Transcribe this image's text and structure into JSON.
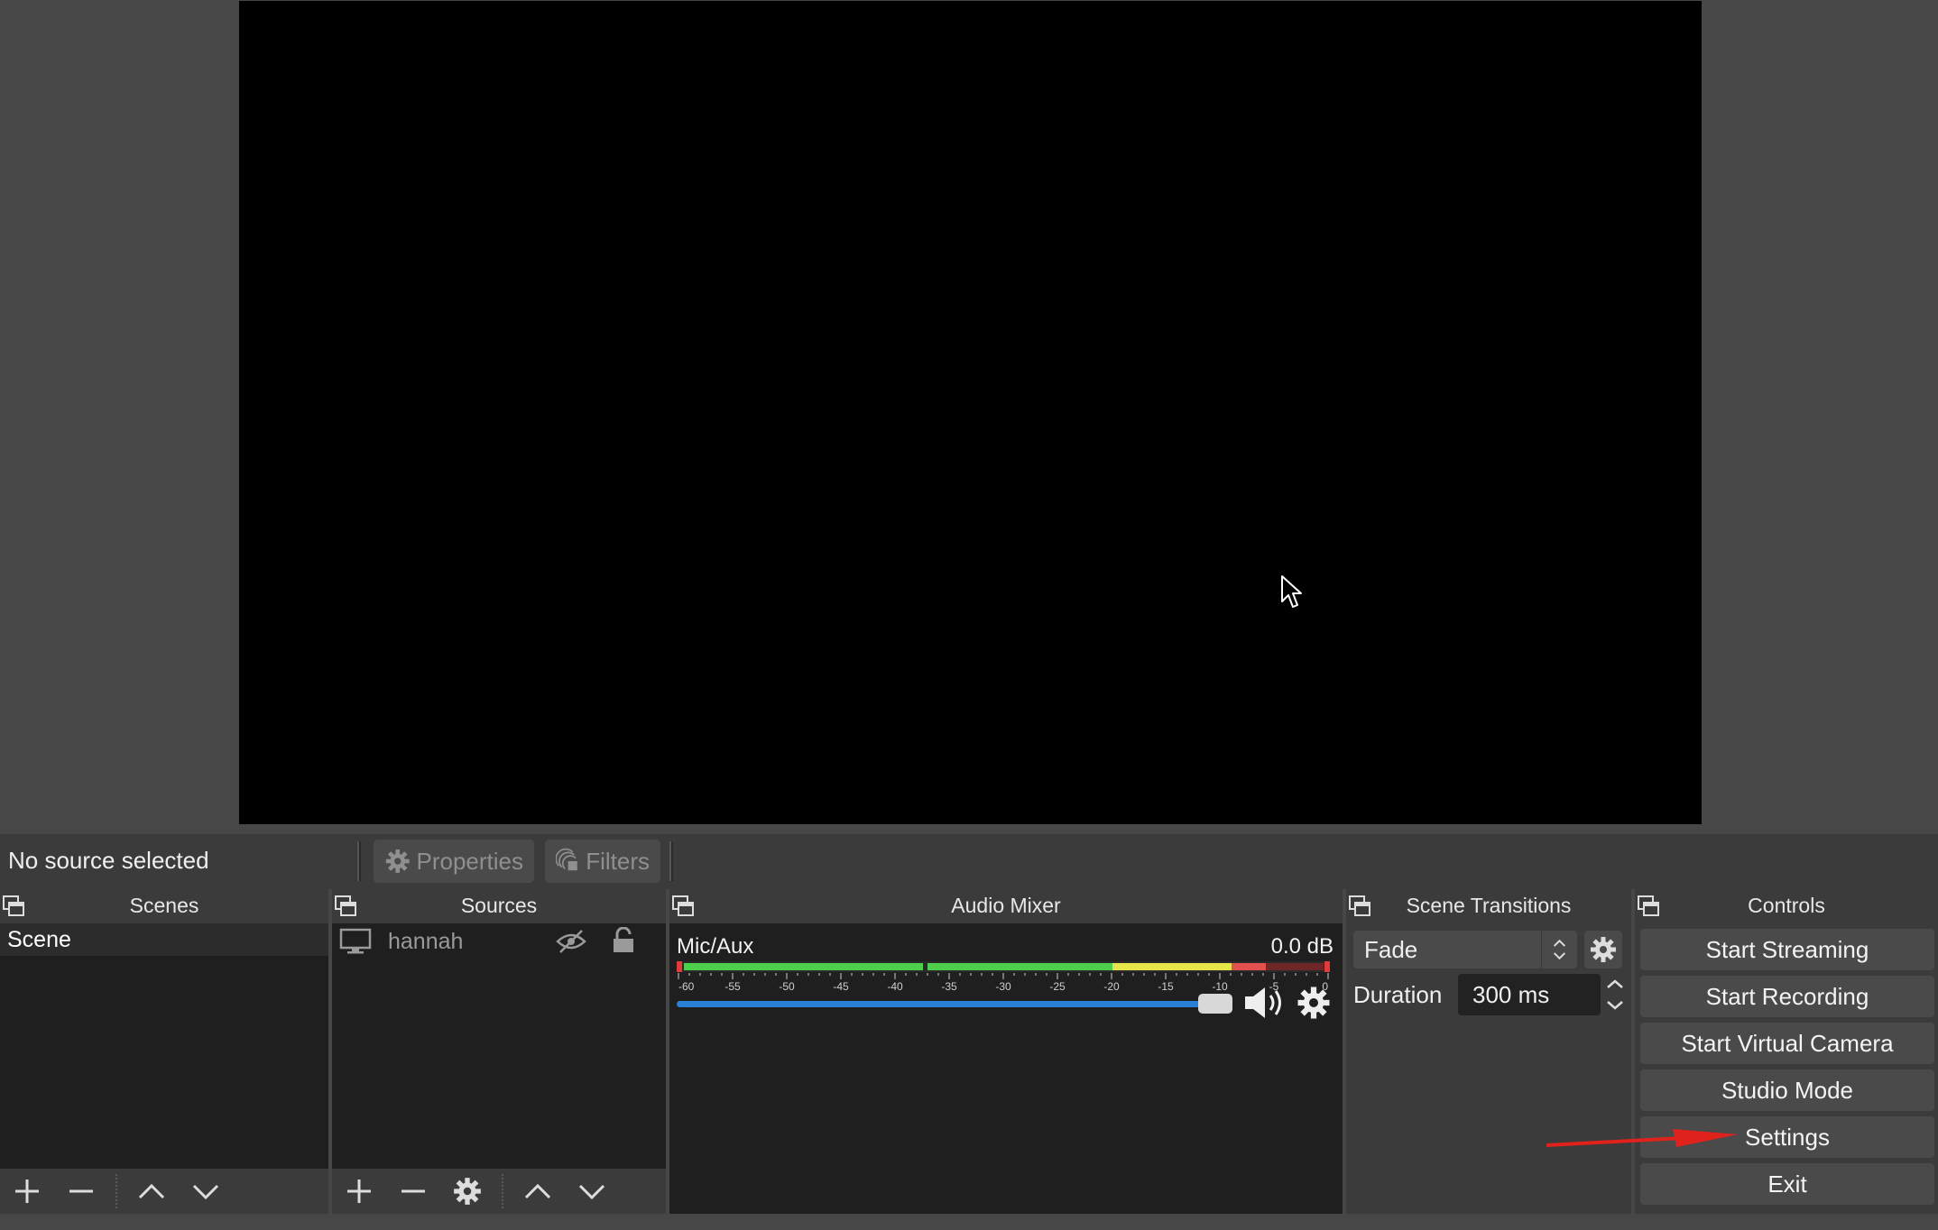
{
  "context": {
    "no_source": "No source selected",
    "properties_label": "Properties",
    "filters_label": "Filters"
  },
  "docks": {
    "scenes": {
      "title": "Scenes",
      "items": [
        "Scene"
      ]
    },
    "sources": {
      "title": "Sources",
      "items": [
        {
          "name": "hannah",
          "icon": "monitor-icon"
        }
      ]
    },
    "mixer": {
      "title": "Audio Mixer",
      "channel": "Mic/Aux",
      "level": "0.0 dB",
      "volume_fraction": 1.0,
      "scale": [
        "-60",
        "-55",
        "-50",
        "-45",
        "-40",
        "-35",
        "-30",
        "-25",
        "-20",
        "-15",
        "-10",
        "-5",
        "0"
      ]
    },
    "transitions": {
      "title": "Scene Transitions",
      "selected": "Fade",
      "duration_label": "Duration",
      "duration_value": "300 ms"
    },
    "controls": {
      "title": "Controls",
      "buttons": [
        "Start Streaming",
        "Start Recording",
        "Start Virtual Camera",
        "Studio Mode",
        "Settings",
        "Exit"
      ]
    }
  },
  "colors": {
    "background": "#474747",
    "panel": "#3b3b3b",
    "accent": "#2a7fd6",
    "annotation": "#e0221d"
  }
}
